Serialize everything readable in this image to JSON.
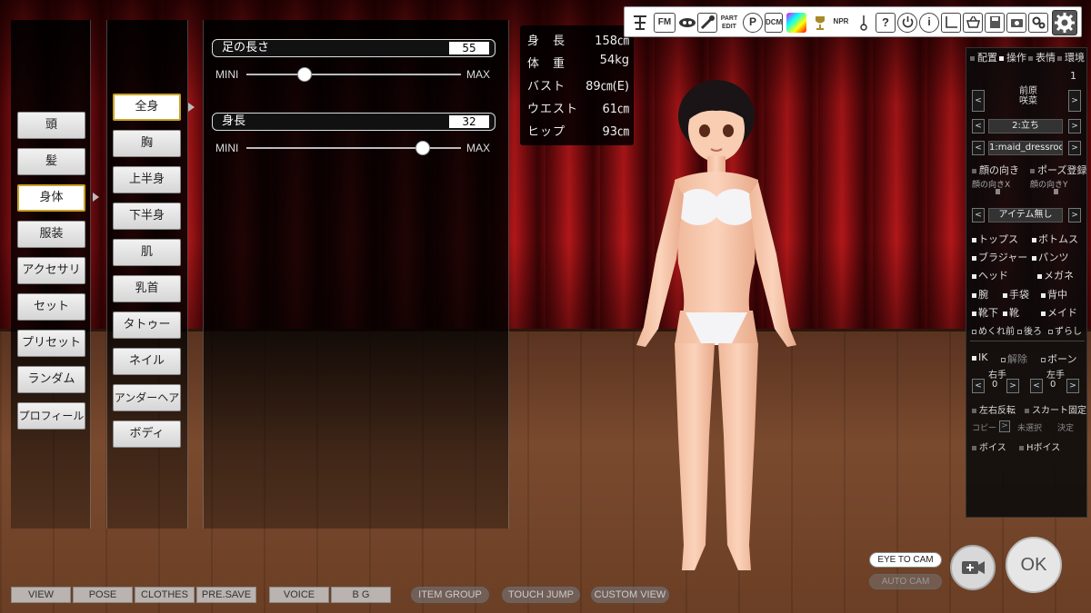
{
  "categories": [
    {
      "label": "頭"
    },
    {
      "label": "髪"
    },
    {
      "label": "身体"
    },
    {
      "label": "服装"
    },
    {
      "label": "アクセサリ"
    },
    {
      "label": "セット"
    },
    {
      "label": "プリセット"
    },
    {
      "label": "ランダム"
    },
    {
      "label": "プロフィール"
    }
  ],
  "active_category": "身体",
  "subcategories": [
    {
      "label": "全身"
    },
    {
      "label": "胸"
    },
    {
      "label": "上半身"
    },
    {
      "label": "下半身"
    },
    {
      "label": "肌"
    },
    {
      "label": "乳首"
    },
    {
      "label": "タトゥー"
    },
    {
      "label": "ネイル"
    },
    {
      "label": "アンダーヘア"
    },
    {
      "label": "ボディ"
    }
  ],
  "active_subcategory": "全身",
  "sliders": [
    {
      "label": "足の長さ",
      "value": "55",
      "min_label": "MINI",
      "max_label": "MAX",
      "fraction": 0.27
    },
    {
      "label": "身長",
      "value": "32",
      "min_label": "MINI",
      "max_label": "MAX",
      "fraction": 0.82
    }
  ],
  "stats": [
    {
      "label": "身　長",
      "value": "158㎝"
    },
    {
      "label": "体　重",
      "value": "54kg"
    },
    {
      "label": "バスト",
      "value": "89㎝(E)"
    },
    {
      "label": "ウエスト",
      "value": "61㎝"
    },
    {
      "label": "ヒップ",
      "value": "93㎝"
    }
  ],
  "toolbar": {
    "fm": "FM",
    "part_edit": "PART EDIT",
    "p": "P",
    "dcm": "DCM",
    "npr": "NPR",
    "help": "?",
    "info": "i"
  },
  "right_panel": {
    "tabs": [
      "配置",
      "操作",
      "表情",
      "環境"
    ],
    "slot_number": "1",
    "character_name": "前原\n咲菜",
    "pose": "2:立ち",
    "motion": "1:maid_dressroo",
    "face_dir": "顔の向き",
    "pose_save": "ポーズ登録",
    "face_x": "顔の向きX",
    "face_y": "顔の向きY",
    "item": "アイテム無し",
    "clothes": [
      {
        "label": "トップス",
        "on": true
      },
      {
        "label": "ボトムス",
        "on": true
      },
      {
        "label": "ブラジャー",
        "on": true
      },
      {
        "label": "パンツ",
        "on": true
      },
      {
        "label": "ヘッド",
        "on": true
      },
      {
        "label": "メガネ",
        "on": true
      },
      {
        "label": "腕",
        "on": true
      },
      {
        "label": "手袋",
        "on": true
      },
      {
        "label": "背中",
        "on": true
      },
      {
        "label": "靴下",
        "on": true
      },
      {
        "label": "靴",
        "on": true
      },
      {
        "label": "メイド",
        "on": true
      },
      {
        "label": "めくれ前",
        "on": false
      },
      {
        "label": "後ろ",
        "on": false
      },
      {
        "label": "ずらし",
        "on": false
      }
    ],
    "ik": "IK",
    "release": "解除",
    "bone": "ボーン",
    "right_hand": "右手",
    "left_hand": "左手",
    "right_hand_value": "0",
    "left_hand_value": "0",
    "lr_flip": "左右反転",
    "skirt_fix": "スカート固定",
    "copy": "コピー",
    "copy_arrow": ">",
    "unselected": "未選択",
    "decide": "決定",
    "voice": "ボイス",
    "h_voice": "Hボイス"
  },
  "bottom_bar": {
    "view": "VIEW",
    "pose": "POSE",
    "clothes": "CLOTHES",
    "pre_save": "PRE.SAVE",
    "voice": "VOICE",
    "bg": "B G",
    "item_group": "ITEM GROUP",
    "touch_jump": "TOUCH JUMP",
    "custom_view": "CUSTOM VIEW"
  },
  "camera": {
    "eye_to_cam": "EYE TO CAM",
    "auto_cam": "AUTO CAM",
    "ok": "OK"
  },
  "colors": {
    "curtain": "#a8161a",
    "floor": "#7a4a2e",
    "active_border": "#c9a227"
  }
}
